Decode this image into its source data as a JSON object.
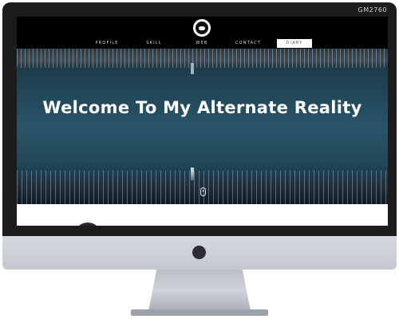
{
  "monitor": {
    "model_label": "GM2760"
  },
  "site": {
    "nav": {
      "items": [
        {
          "label": "PROFILE",
          "active": false
        },
        {
          "label": "SKILL",
          "active": false
        },
        {
          "label": "WEB",
          "active": false
        },
        {
          "label": "CONTACT",
          "active": false
        },
        {
          "label": "DIARY",
          "active": true
        }
      ]
    },
    "hero": {
      "title": "Welcome To My Alternate Reality"
    }
  },
  "colors": {
    "nav_background": "#000000",
    "hero_tint": "#21475a",
    "active_tab_background": "#ffffff",
    "monitor_bezel": "#1c1c1e",
    "monitor_body": "#c4c9d0"
  },
  "icons": {
    "logo": "round-emblem-icon",
    "scroll": "mouse-scroll-icon"
  }
}
